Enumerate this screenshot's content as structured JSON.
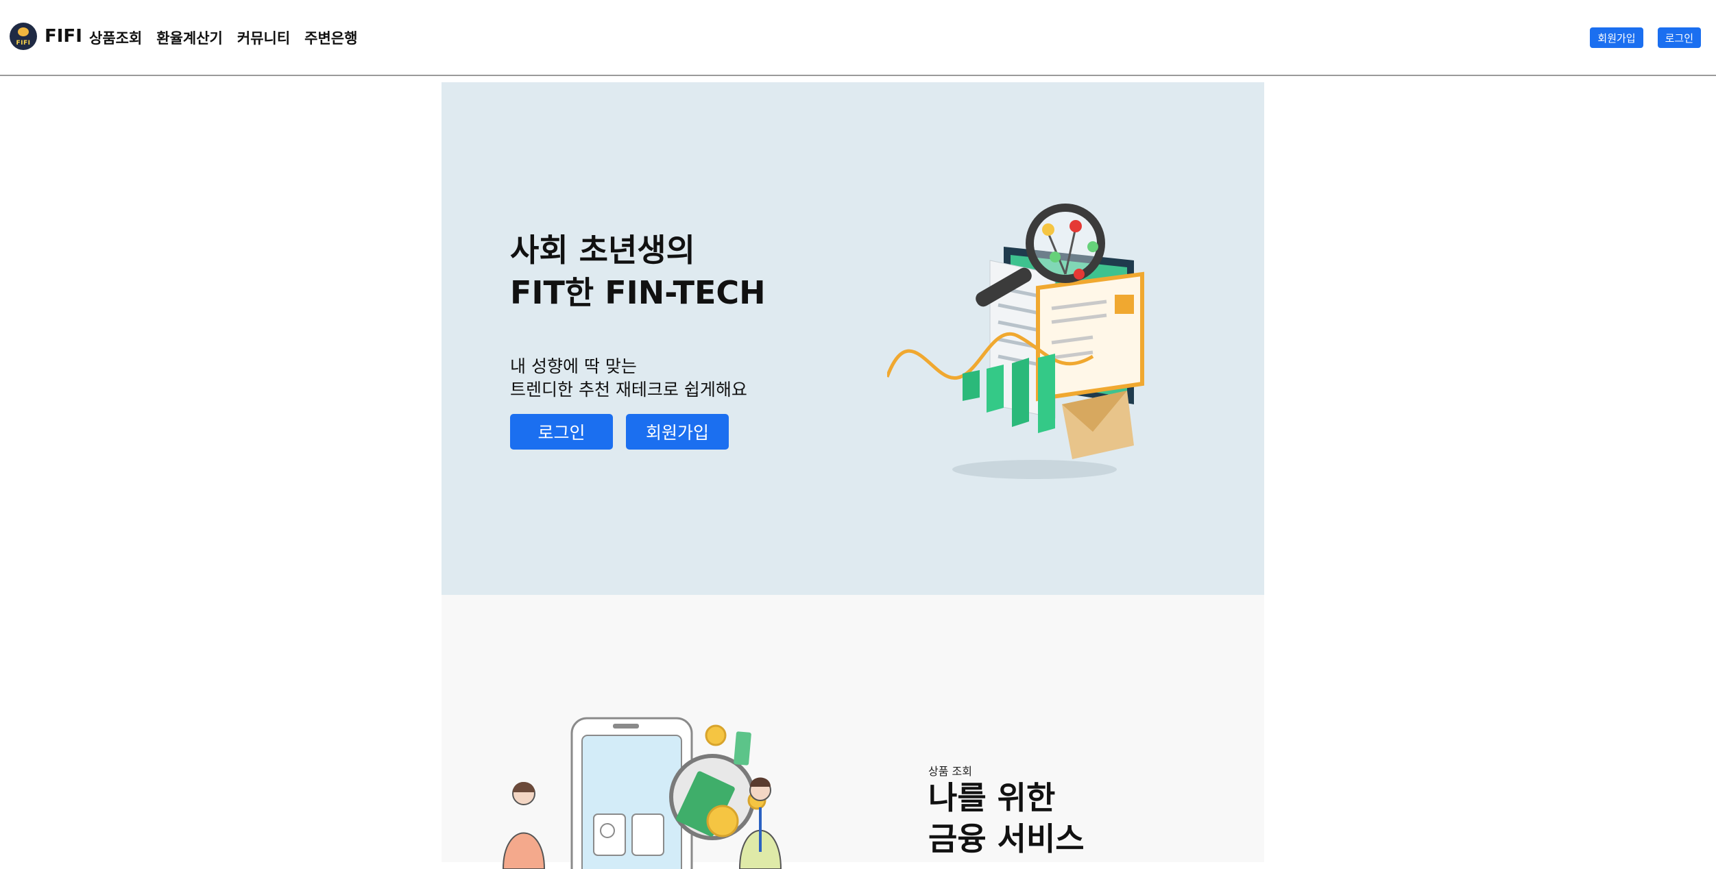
{
  "navbar": {
    "brand_name": "FIFI",
    "logo_text": "FIFI",
    "links": [
      "상품조회",
      "환율계산기",
      "커뮤니티",
      "주변은행"
    ],
    "signup_label": "회원가입",
    "login_label": "로그인"
  },
  "hero": {
    "title_lines": [
      "사회 초년생의",
      "FIT한 FIN-TECH"
    ],
    "subtitle_lines": [
      "내 성향에 딱 맞는",
      "트렌디한 추천 재테크로 쉽게해요"
    ],
    "login_label": "로그인",
    "signup_label": "회원가입",
    "illustration_icon": "financial-report-illustration"
  },
  "section2": {
    "kicker": "상품 조회",
    "title_lines": [
      "나를 위한",
      "금융 서비스"
    ],
    "illustration_icon": "mobile-banking-illustration"
  },
  "colors": {
    "accent": "#1b6ff0",
    "hero_bg": "#dfeaf0",
    "section_bg": "#f8f8f8",
    "nav_border": "#9a9a9a"
  }
}
